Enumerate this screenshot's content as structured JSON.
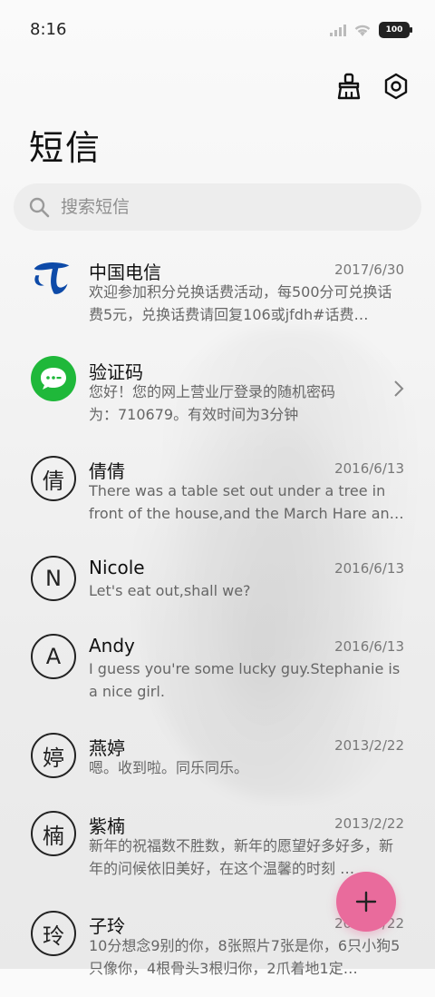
{
  "status": {
    "time": "8:16",
    "battery": "100"
  },
  "header": {
    "title": "短信"
  },
  "search": {
    "placeholder": "搜索短信"
  },
  "messages": [
    {
      "name": "中国电信",
      "date": "2017/6/30",
      "preview": "欢迎参加积分兑换话费活动，每500分可兑换话费5元，兑换话费请回复106或jfdh#话费…",
      "avatar": "telecom-logo"
    },
    {
      "name": "验证码",
      "date": "",
      "preview": "您好！您的网上营业厅登录的随机密码为：710679。有效时间为3分钟",
      "avatar": "message-bubble"
    },
    {
      "name": "倩倩",
      "date": "2016/6/13",
      "preview": "There was a table set out under a tree in front of the house,and the March Hare an…",
      "avatar": "倩"
    },
    {
      "name": "Nicole",
      "date": "2016/6/13",
      "preview": "Let's eat out,shall we?",
      "avatar": "N"
    },
    {
      "name": "Andy",
      "date": "2016/6/13",
      "preview": "I guess you're some lucky guy.Stephanie is a nice girl.",
      "avatar": "A"
    },
    {
      "name": "燕婷",
      "date": "2013/2/22",
      "preview": "嗯。收到啦。同乐同乐。",
      "avatar": "婷"
    },
    {
      "name": "紫楠",
      "date": "2013/2/22",
      "preview": "新年的祝福数不胜数，新年的愿望好多好多，新年的问候依旧美好，在这个温馨的时刻 …",
      "avatar": "楠"
    },
    {
      "name": "子玲",
      "date": "2013/2/22",
      "preview": "10分想念9别的你，8张照片7张是你，6只小狗5只像你，4根骨头3根归你，2爪着地1定…",
      "avatar": "玲"
    }
  ],
  "colors": {
    "accent": "#e96b9c",
    "telecom_blue": "#0d4aa8",
    "bubble_green": "#1fb83a"
  }
}
